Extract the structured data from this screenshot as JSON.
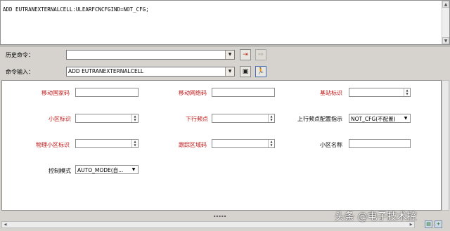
{
  "output": {
    "command_text": "ADD EUTRANEXTERNALCELL:ULEARFCNCFGIND=NOT_CFG;"
  },
  "command_panel": {
    "history_label": "历史命令：",
    "history_value": "",
    "input_label": "命令输入：",
    "input_value": "ADD EUTRANEXTERNALCELL"
  },
  "params": {
    "mcc_label": "移动国家码",
    "mnc_label": "移动网络码",
    "enodeb_label": "基站标识",
    "cell_id_label": "小区标识",
    "dl_earfcn_label": "下行频点",
    "ul_earfcn_ind_label": "上行频点配置指示",
    "ul_earfcn_ind_value": "NOT_CFG(不配置)",
    "pci_label": "物理小区标识",
    "tac_label": "跟踪区域码",
    "cell_name_label": "小区名称",
    "ctrl_mode_label": "控制模式",
    "ctrl_mode_value": "AUTO_MODE(自..."
  },
  "watermark": "头条 @电子技术控",
  "colors": {
    "required_label": "#c01515",
    "panel_bg": "#d6d3ce"
  }
}
